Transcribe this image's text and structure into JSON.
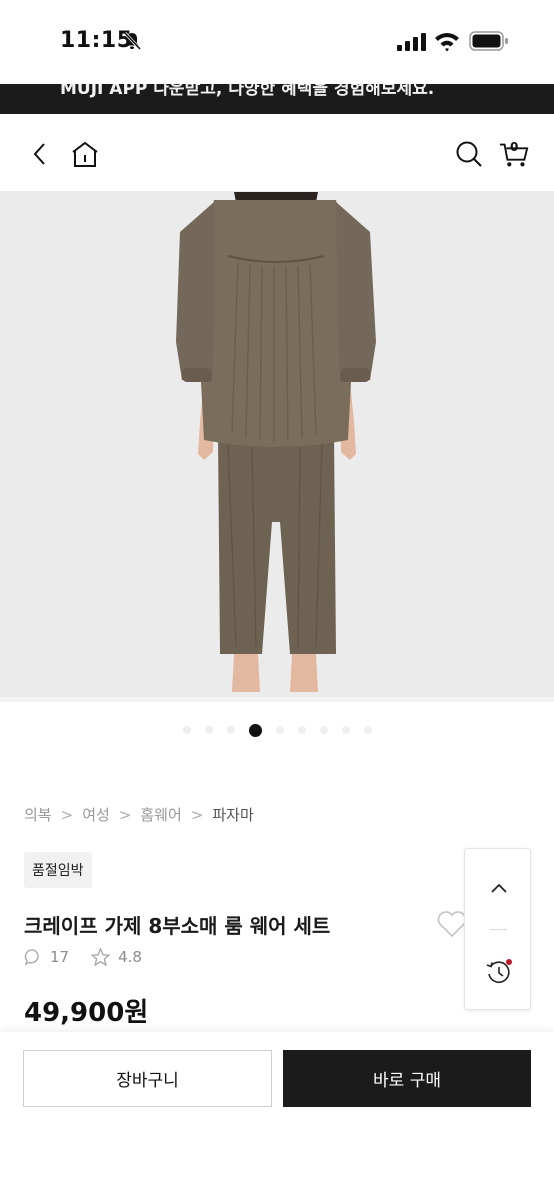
{
  "status_bar": {
    "time": "11:15"
  },
  "banner": {
    "text": "MUJI APP 다운받고, 다양한 혜택을 경험해보세요."
  },
  "nav": {
    "icons": [
      "chevron-left-icon",
      "home-icon",
      "search-icon",
      "cart-icon"
    ],
    "cart_count": "0"
  },
  "gallery": {
    "image_subject": "brown crepe gauze pajama set (back view)",
    "slide_count": 9,
    "active_slide": 4
  },
  "breadcrumb": {
    "items": [
      "의복",
      "여성",
      "홈웨어"
    ],
    "current": "파자마",
    "separator": ">"
  },
  "product": {
    "badge": "품절임박",
    "title": "크레이프 가제 8부소매 룸 웨어 세트",
    "review_count": "17",
    "rating": "4.8",
    "price": "49,900원"
  },
  "floating_panel": {
    "icons": [
      "chevron-up-icon",
      "history-icon"
    ]
  },
  "actions": {
    "cart_label": "장바구니",
    "buy_label": "바로 구매"
  },
  "colors": {
    "banner_bg": "#1b1b1b",
    "buy_button_bg": "#1b1b1b",
    "garment": "#7a6d5b",
    "notification_dot": "#c0182b"
  }
}
